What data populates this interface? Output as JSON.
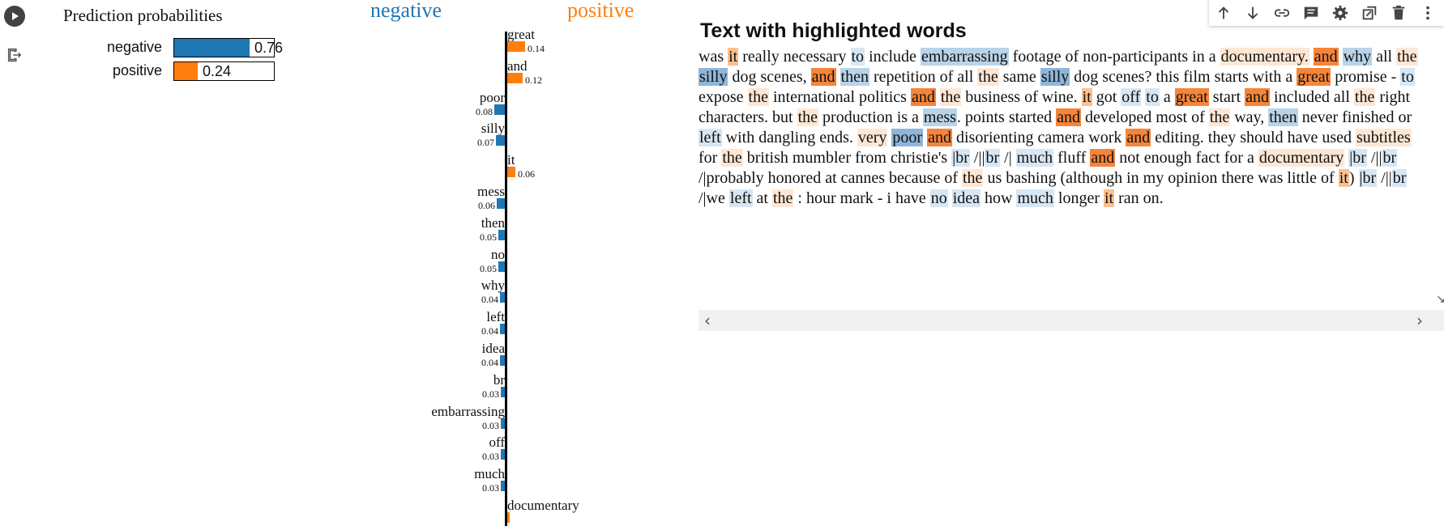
{
  "gutter": {
    "run_icon": "play-circle-icon",
    "output_icon": "output-exit-icon"
  },
  "toolbar": {
    "buttons": [
      {
        "name": "move-up",
        "icon": "arrow-up-icon"
      },
      {
        "name": "move-down",
        "icon": "arrow-down-icon"
      },
      {
        "name": "link",
        "icon": "link-icon"
      },
      {
        "name": "comment",
        "icon": "comment-icon"
      },
      {
        "name": "settings",
        "icon": "gear-icon"
      },
      {
        "name": "mirror",
        "icon": "mirror-cell-icon"
      },
      {
        "name": "delete",
        "icon": "trash-icon"
      },
      {
        "name": "more",
        "icon": "more-vert-icon"
      }
    ]
  },
  "prediction": {
    "title": "Prediction probabilities",
    "classes": [
      {
        "label": "negative",
        "value": "0.76",
        "fraction": 0.76,
        "color": "#1f77b4"
      },
      {
        "label": "positive",
        "value": "0.24",
        "fraction": 0.24,
        "color": "#ff7f0e"
      }
    ]
  },
  "explanation": {
    "neg_heading": "negative",
    "pos_heading": "positive",
    "colors": {
      "negative": "#1f77b4",
      "positive": "#ff7f0e"
    },
    "features": [
      {
        "word": "great",
        "value": "0.14",
        "weight": 0.14,
        "side": "positive"
      },
      {
        "word": "and",
        "value": "0.12",
        "weight": 0.12,
        "side": "positive"
      },
      {
        "word": "poor",
        "value": "0.08",
        "weight": 0.08,
        "side": "negative"
      },
      {
        "word": "silly",
        "value": "0.07",
        "weight": 0.07,
        "side": "negative"
      },
      {
        "word": "it",
        "value": "0.06",
        "weight": 0.06,
        "side": "positive"
      },
      {
        "word": "mess",
        "value": "0.06",
        "weight": 0.06,
        "side": "negative"
      },
      {
        "word": "then",
        "value": "0.05",
        "weight": 0.05,
        "side": "negative"
      },
      {
        "word": "no",
        "value": "0.05",
        "weight": 0.05,
        "side": "negative"
      },
      {
        "word": "why",
        "value": "0.04",
        "weight": 0.04,
        "side": "negative"
      },
      {
        "word": "left",
        "value": "0.04",
        "weight": 0.04,
        "side": "negative"
      },
      {
        "word": "idea",
        "value": "0.04",
        "weight": 0.04,
        "side": "negative"
      },
      {
        "word": "br",
        "value": "0.03",
        "weight": 0.03,
        "side": "negative"
      },
      {
        "word": "embarrassing",
        "value": "0.03",
        "weight": 0.03,
        "side": "negative"
      },
      {
        "word": "off",
        "value": "0.03",
        "weight": 0.03,
        "side": "negative"
      },
      {
        "word": "much",
        "value": "0.03",
        "weight": 0.03,
        "side": "negative"
      },
      {
        "word": "documentary",
        "value": "",
        "weight": 0.02,
        "side": "positive"
      }
    ]
  },
  "highlighted": {
    "title": "Text with highlighted words",
    "tokens": [
      {
        "t": "was "
      },
      {
        "t": "it",
        "h": "p2"
      },
      {
        "t": " really necessary "
      },
      {
        "t": "to",
        "h": "n1"
      },
      {
        "t": " include "
      },
      {
        "t": "embarrassing",
        "h": "n2"
      },
      {
        "t": " footage of non-participants in a "
      },
      {
        "t": "documentary.",
        "h": "p1"
      },
      {
        "t": " "
      },
      {
        "t": "and",
        "h": "p3"
      },
      {
        "t": " "
      },
      {
        "t": "why",
        "h": "n2"
      },
      {
        "t": " all "
      },
      {
        "t": "the",
        "h": "p1"
      },
      {
        "t": " "
      },
      {
        "t": "silly",
        "h": "n3"
      },
      {
        "t": " dog scenes, "
      },
      {
        "t": "and",
        "h": "p3"
      },
      {
        "t": " "
      },
      {
        "t": "then",
        "h": "n2"
      },
      {
        "t": " repetition of all "
      },
      {
        "t": "the",
        "h": "p1"
      },
      {
        "t": " same "
      },
      {
        "t": "silly",
        "h": "n3"
      },
      {
        "t": " dog scenes? this film starts with a "
      },
      {
        "t": "great",
        "h": "p3"
      },
      {
        "t": " promise - "
      },
      {
        "t": "to",
        "h": "n1"
      },
      {
        "t": " expose "
      },
      {
        "t": "the",
        "h": "p1"
      },
      {
        "t": " international politics "
      },
      {
        "t": "and",
        "h": "p3"
      },
      {
        "t": " "
      },
      {
        "t": "the",
        "h": "p1"
      },
      {
        "t": " business of wine. "
      },
      {
        "t": "it",
        "h": "p2"
      },
      {
        "t": " got "
      },
      {
        "t": "off",
        "h": "n1"
      },
      {
        "t": " "
      },
      {
        "t": "to",
        "h": "n1"
      },
      {
        "t": " a "
      },
      {
        "t": "great",
        "h": "p3"
      },
      {
        "t": " start "
      },
      {
        "t": "and",
        "h": "p3"
      },
      {
        "t": " included all "
      },
      {
        "t": "the",
        "h": "p1"
      },
      {
        "t": " right characters. but "
      },
      {
        "t": "the",
        "h": "p1"
      },
      {
        "t": " production is a "
      },
      {
        "t": "mess",
        "h": "n2"
      },
      {
        "t": ". points started "
      },
      {
        "t": "and",
        "h": "p3"
      },
      {
        "t": " developed most of "
      },
      {
        "t": "the",
        "h": "p1"
      },
      {
        "t": " way, "
      },
      {
        "t": "then",
        "h": "n2"
      },
      {
        "t": " never finished or "
      },
      {
        "t": "left",
        "h": "n1"
      },
      {
        "t": " with dangling ends. "
      },
      {
        "t": "very",
        "h": "p1"
      },
      {
        "t": " "
      },
      {
        "t": "poor",
        "h": "n3"
      },
      {
        "t": " "
      },
      {
        "t": "and",
        "h": "p3"
      },
      {
        "t": " disorienting camera work "
      },
      {
        "t": "and",
        "h": "p3"
      },
      {
        "t": " editing. they should have used "
      },
      {
        "t": "subtitles",
        "h": "p1"
      },
      {
        "t": " for "
      },
      {
        "t": "the",
        "h": "p1"
      },
      {
        "t": " british mumbler from christie's "
      },
      {
        "t": "|br",
        "h": "n1"
      },
      {
        "t": " /||"
      },
      {
        "t": "br",
        "h": "n1"
      },
      {
        "t": " /| "
      },
      {
        "t": "much",
        "h": "n1"
      },
      {
        "t": " fluff "
      },
      {
        "t": "and",
        "h": "p3"
      },
      {
        "t": " not enough fact for a "
      },
      {
        "t": "documentary",
        "h": "p1"
      },
      {
        "t": " "
      },
      {
        "t": "|br",
        "h": "n1"
      },
      {
        "t": " /||"
      },
      {
        "t": "br",
        "h": "n1"
      },
      {
        "t": " /|probably honored at cannes because of "
      },
      {
        "t": "the",
        "h": "p1"
      },
      {
        "t": " us bashing (although in my opinion there was little of "
      },
      {
        "t": "it",
        "h": "p2"
      },
      {
        "t": ") "
      },
      {
        "t": "|br",
        "h": "n1"
      },
      {
        "t": " /||"
      },
      {
        "t": "br",
        "h": "n1"
      },
      {
        "t": " /|we "
      },
      {
        "t": "left",
        "h": "n1"
      },
      {
        "t": " at "
      },
      {
        "t": "the",
        "h": "p1"
      },
      {
        "t": " : hour mark - i have "
      },
      {
        "t": "no",
        "h": "n1"
      },
      {
        "t": " "
      },
      {
        "t": "idea",
        "h": "n1"
      },
      {
        "t": " how "
      },
      {
        "t": "much",
        "h": "n1"
      },
      {
        "t": " longer "
      },
      {
        "t": "it",
        "h": "p2"
      },
      {
        "t": " ran on."
      }
    ],
    "highlight_colors": {
      "p1": "#fde7d4",
      "p2": "#fdc08e",
      "p3": "#f5853a",
      "n1": "#d7e6f3",
      "n2": "#b9d3e8",
      "n3": "#8fb6d8"
    }
  },
  "scrollbar": {
    "left_arrow": "‹",
    "right_arrow": "›"
  },
  "resize_mark": "↘"
}
